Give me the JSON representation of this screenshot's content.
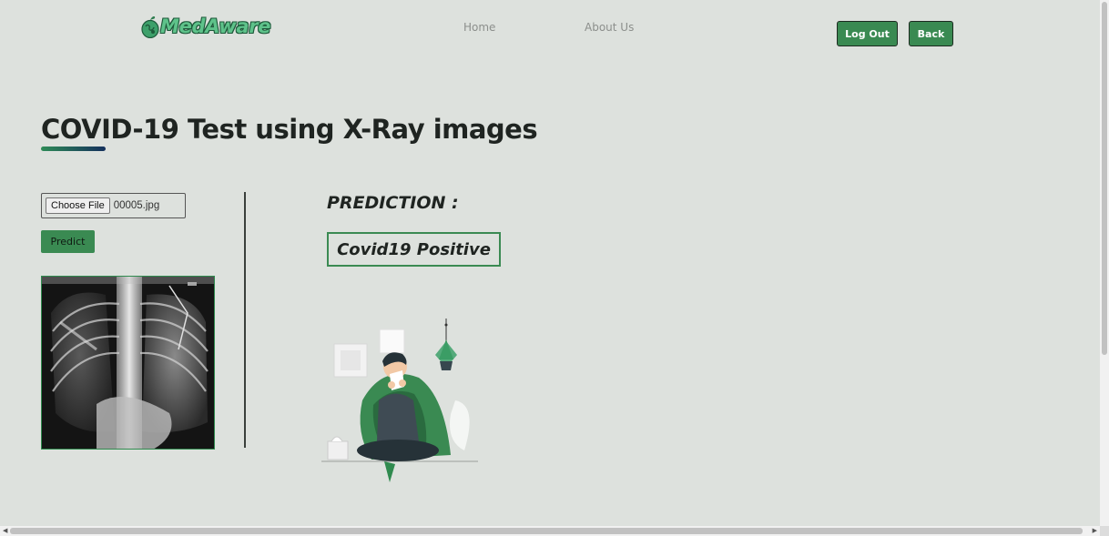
{
  "nav": {
    "logo_text": "MedAware",
    "links": [
      "Home",
      "About Us"
    ],
    "logout_label": "Log Out",
    "back_label": "Back",
    "accent_color": "#3a8a52"
  },
  "main": {
    "title": "COVID-19 Test using X-Ray images",
    "file_input": {
      "button_label": "Choose File",
      "file_name": "00005.jpg"
    },
    "predict_label": "Predict",
    "prediction_label": "PREDICTION :",
    "prediction_result": "Covid19 Positive",
    "xray_icon": "chest-xray-image",
    "illustration_icon": "sick-person-sneezing-illustration"
  }
}
